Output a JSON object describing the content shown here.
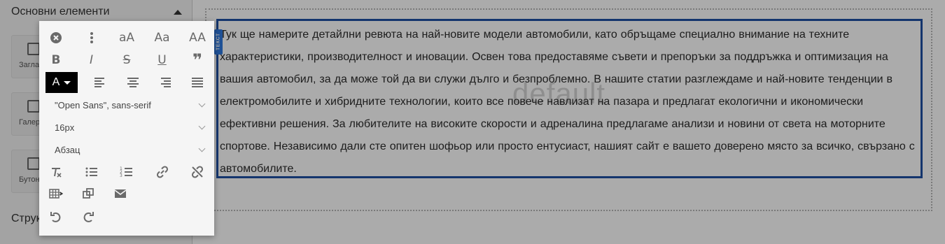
{
  "sidebar": {
    "section_title": "Основни елементи",
    "cards": [
      {
        "label": "Заглавие",
        "icon": "heading-icon"
      },
      {
        "label": "Галерия",
        "icon": "grid-icon"
      },
      {
        "label": "Бутон",
        "icon": "button-icon"
      }
    ],
    "structure_title": "Структура"
  },
  "toolbar": {
    "font_family": "\"Open Sans\", sans-serif",
    "font_size": "16px",
    "block_format": "Абзац",
    "color_label": "A",
    "case_small": "aA",
    "case_title": "Aa",
    "case_upper": "AA",
    "bold": "B",
    "italic": "I",
    "strike": "S",
    "underline": "U",
    "quote": "❞"
  },
  "editor": {
    "block_tag": "ТЕКСТ",
    "watermark": "default",
    "text": "Тук ще намерите детайлни ревюта на най-новите модели автомобили, като обръщаме специално внимание на техните характеристики, производителност и иновации. Освен това предоставяме съвети и препоръки за поддръжка и оптимизация на вашия автомобил, за да може той да ви служи дълго и безпроблемно. В нашите статии разглеждаме и най-новите тенденции в електромобилите и хибридните технологии, които все повече навлизат на пазара и предлагат екологични и икономически ефективни решения. За любителите на високите скорости и адреналина предлагаме анализи и новини от света на моторните спортове. Независимо дали сте опитен шофьор или просто ентусиаст, нашият сайт е вашето доверено място за всичко, свързано с автомобилите."
  },
  "colors": {
    "selection_border": "#1f4fa3",
    "tag_bg": "#2f7ae0",
    "overlay": "rgba(0,0,0,0.33)"
  }
}
